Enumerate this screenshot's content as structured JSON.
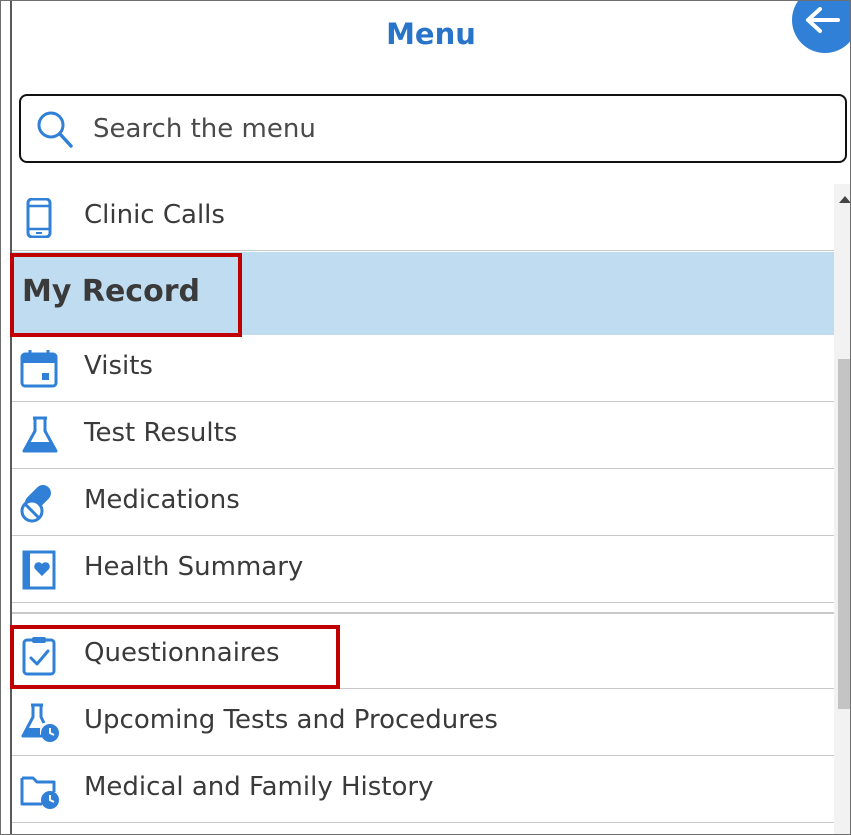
{
  "header": {
    "title": "Menu",
    "back_icon": "arrow-left-icon"
  },
  "search": {
    "placeholder": "Search the menu",
    "value": ""
  },
  "menu": {
    "top_item": {
      "label": "Clinic Calls",
      "icon": "mobile-phone-icon"
    },
    "section": {
      "label": "My Record"
    },
    "items": [
      {
        "label": "Visits",
        "icon": "calendar-icon"
      },
      {
        "label": "Test Results",
        "icon": "flask-icon"
      },
      {
        "label": "Medications",
        "icon": "pills-icon"
      },
      {
        "label": "Health Summary",
        "icon": "heart-document-icon"
      },
      {
        "label": "Questionnaires",
        "icon": "clipboard-check-icon"
      },
      {
        "label": "Upcoming Tests and Procedures",
        "icon": "flask-clock-icon"
      },
      {
        "label": "Medical and Family History",
        "icon": "folder-clock-icon"
      }
    ]
  },
  "colors": {
    "accent": "#2874c9",
    "section_bg": "#c0dcf0",
    "highlight": "#c00000",
    "icon": "#2f80d6"
  }
}
